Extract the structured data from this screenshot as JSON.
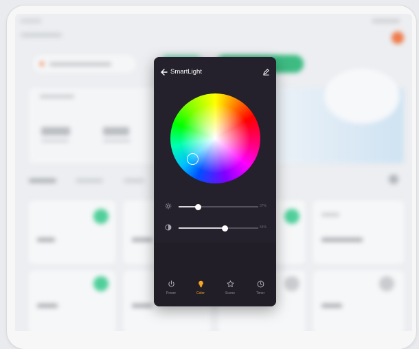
{
  "modal": {
    "title": "SmartLight",
    "brightness_value": "37%",
    "saturation_value": "54%",
    "brightness_level": 0.24,
    "saturation_level": 0.58
  },
  "tabs": [
    {
      "label": "Power",
      "icon": "power-icon"
    },
    {
      "label": "Color",
      "icon": "bulb-icon",
      "active": true
    },
    {
      "label": "Scene",
      "icon": "star-icon"
    },
    {
      "label": "Timer",
      "icon": "clock-icon"
    }
  ],
  "colors": {
    "accent": "#f5a623",
    "modal_bg": "#24212c",
    "background_green": "#4fcf9a"
  }
}
